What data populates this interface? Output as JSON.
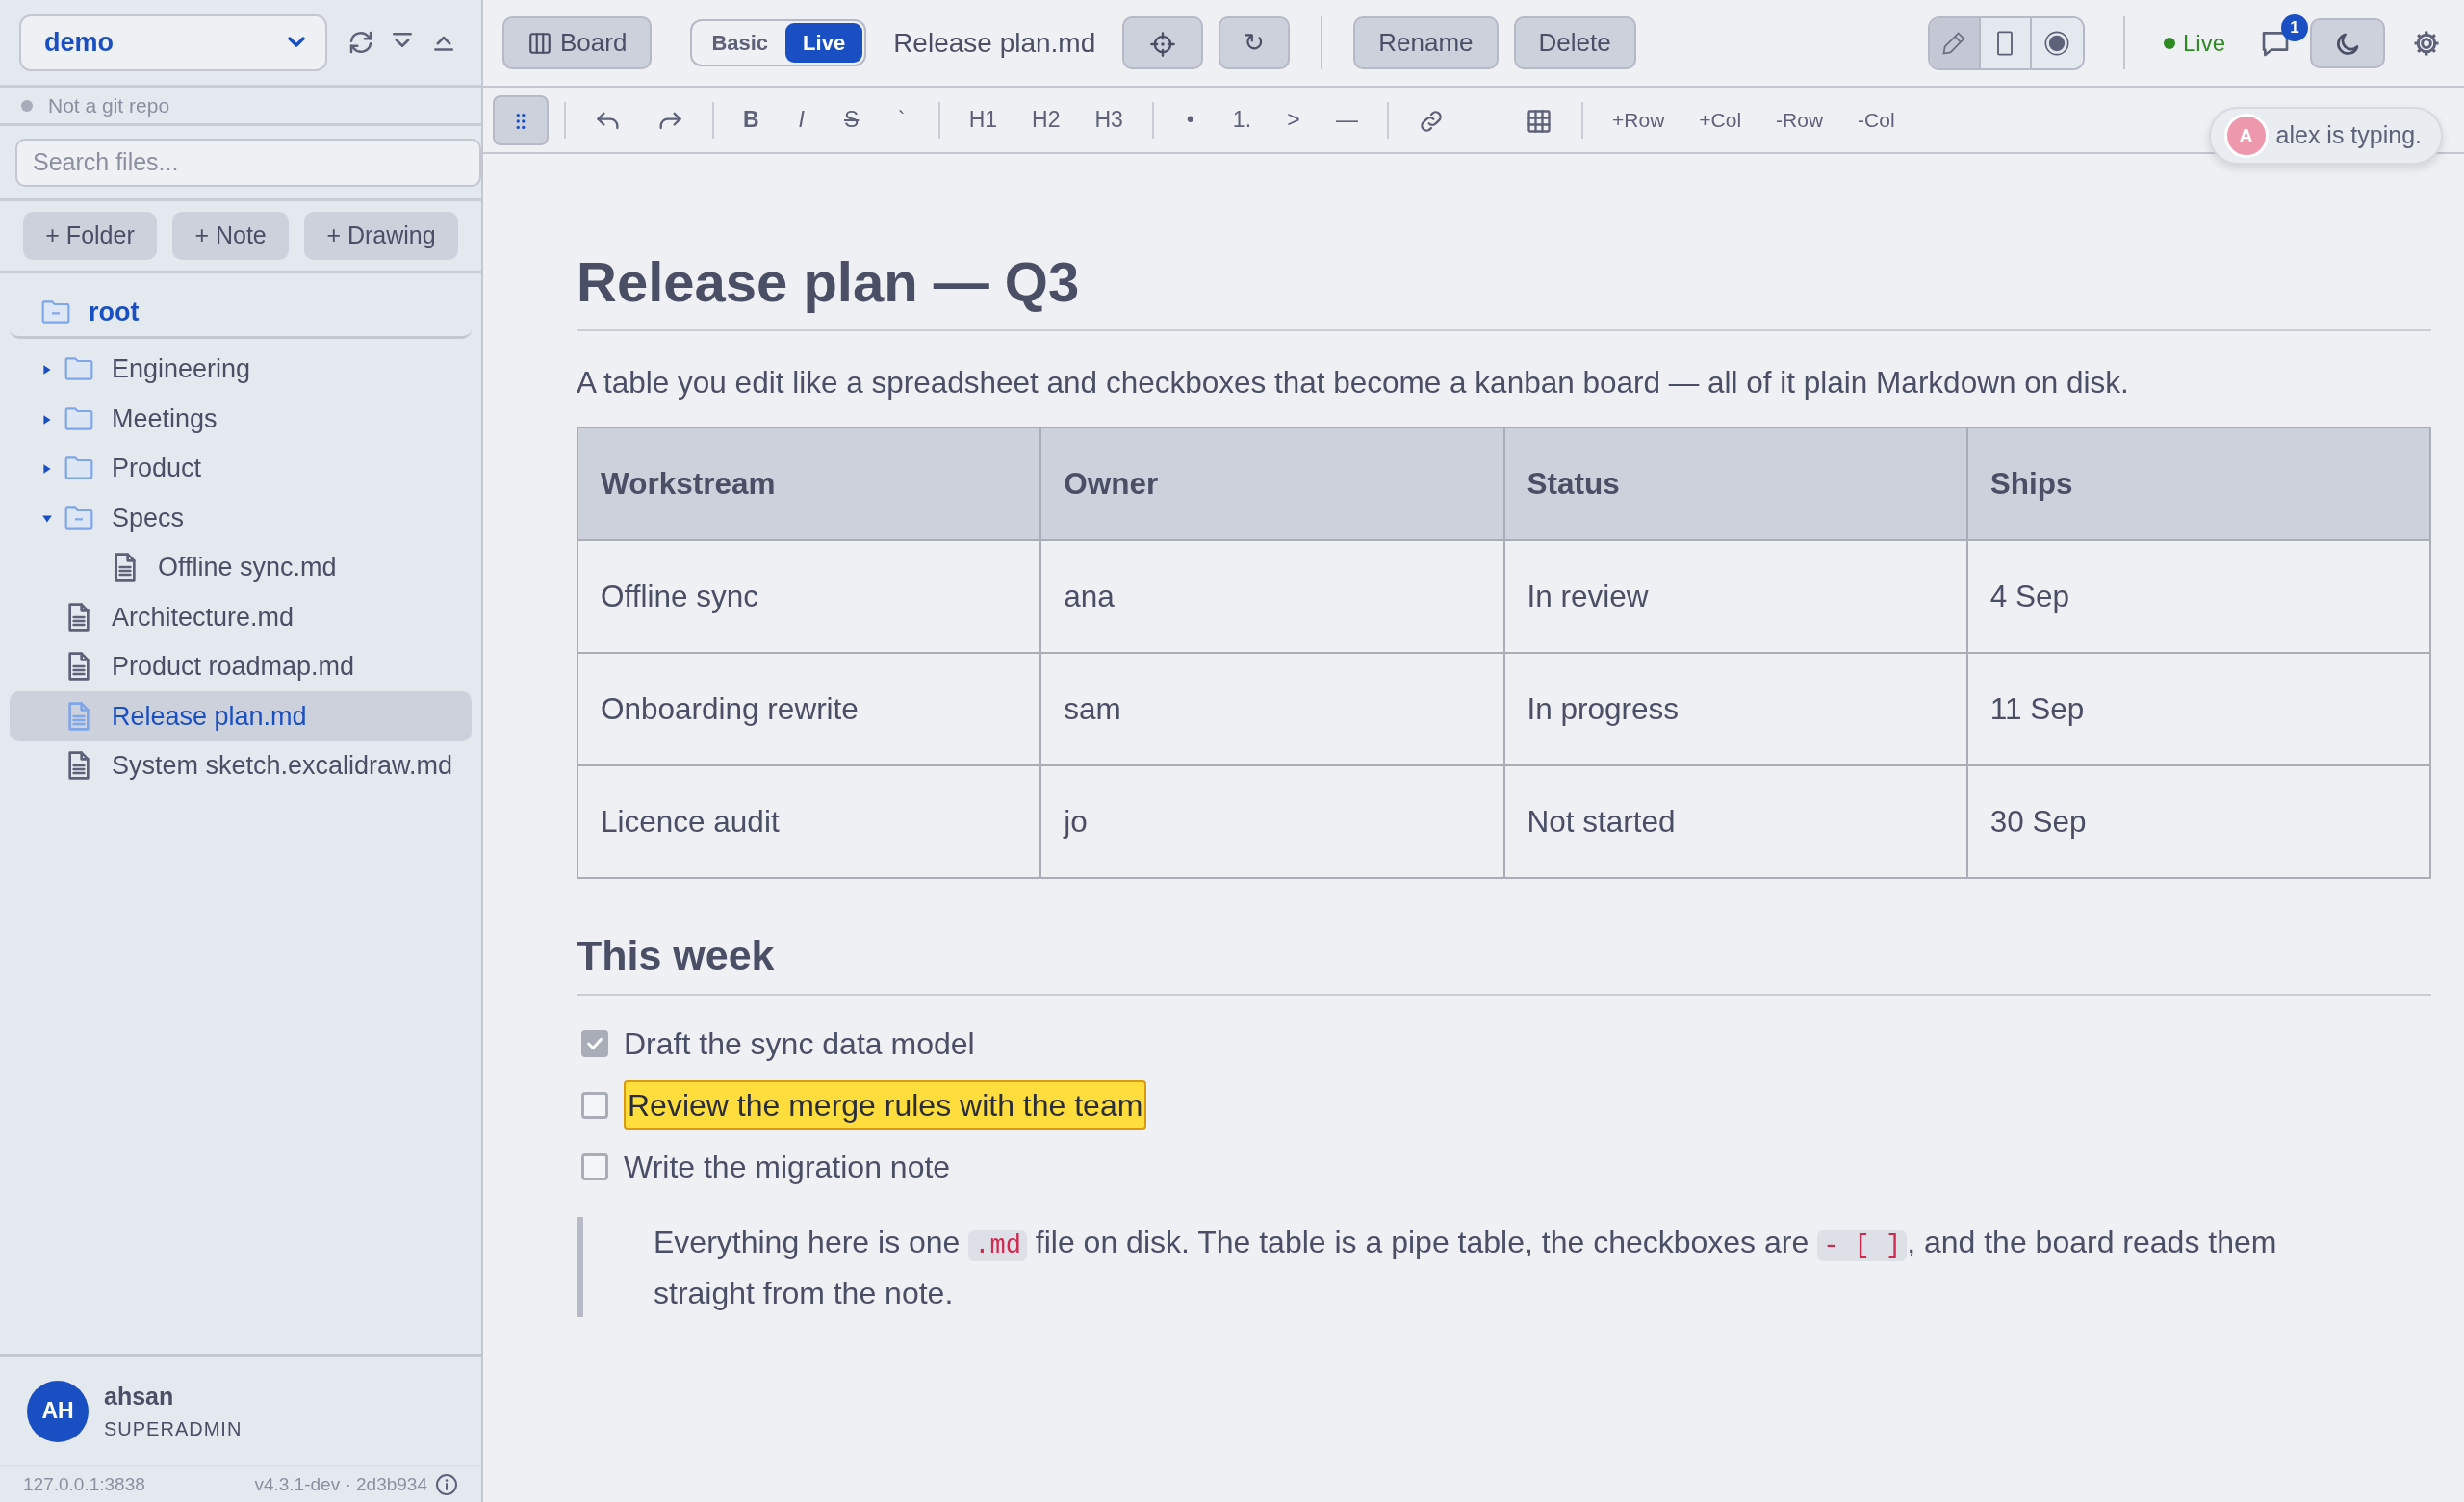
{
  "sidebar": {
    "workspace": "demo",
    "git_status": "Not a git repo",
    "search": {
      "placeholder": "Search files..."
    },
    "create_buttons": [
      "+ Folder",
      "+ Note",
      "+ Drawing"
    ],
    "tree": {
      "label": "root",
      "expanded": true,
      "children": [
        {
          "label": "Engineering",
          "kind": "folder",
          "expanded": false,
          "selected": false
        },
        {
          "label": "Meetings",
          "kind": "folder",
          "expanded": false,
          "selected": false
        },
        {
          "label": "Product",
          "kind": "folder",
          "expanded": false,
          "selected": false
        },
        {
          "label": "Specs",
          "kind": "folder",
          "expanded": true,
          "selected": false,
          "children": [
            {
              "label": "Offline sync.md",
              "kind": "file",
              "selected": false
            }
          ]
        },
        {
          "label": "Architecture.md",
          "kind": "file",
          "selected": false
        },
        {
          "label": "Product roadmap.md",
          "kind": "file",
          "selected": false
        },
        {
          "label": "Release plan.md",
          "kind": "file",
          "selected": true
        },
        {
          "label": "System sketch.excalidraw.md",
          "kind": "file",
          "selected": false
        }
      ]
    },
    "user": {
      "initials": "AH",
      "name": "ahsan",
      "role": "SUPERADMIN"
    },
    "footer": {
      "host": "127.0.0.1:3838",
      "version": "v4.3.1-dev · 2d3b934"
    }
  },
  "topbar": {
    "board_button": "Board",
    "modes": [
      {
        "label": "Basic",
        "selected": false
      },
      {
        "label": "Live",
        "selected": true
      }
    ],
    "file_name": "Release plan.md",
    "reload_button": "↻",
    "actions": [
      "Rename",
      "Delete"
    ],
    "views": [
      {
        "selected": true
      },
      {
        "selected": false
      },
      {
        "selected": false
      }
    ],
    "status": "Live",
    "comments_badge": "1",
    "dark_mode": true
  },
  "toolbar": {
    "handle_active": true,
    "format": [
      "B",
      "I",
      "S",
      "`"
    ],
    "headings": [
      "H1",
      "H2",
      "H3"
    ],
    "blocks": [
      "•",
      "1.",
      ">",
      "—"
    ],
    "table_ops": [
      "+Row",
      "+Col",
      "-Row",
      "-Col"
    ]
  },
  "presence": {
    "initial": "A",
    "text": "alex is typing."
  },
  "document": {
    "title": "Release plan — Q3",
    "intro": "A table you edit like a spreadsheet and checkboxes that become a kanban board — all of it plain Markdown on disk.",
    "table": {
      "columns": [
        "Workstream",
        "Owner",
        "Status",
        "Ships"
      ],
      "rows": [
        [
          "Offline sync",
          "ana",
          "In review",
          "4 Sep"
        ],
        [
          "Onboarding rewrite",
          "sam",
          "In progress",
          "11 Sep"
        ],
        [
          "Licence audit",
          "jo",
          "Not started",
          "30 Sep"
        ]
      ]
    },
    "section": "This week",
    "tasks": [
      {
        "text": "Draft the sync data model",
        "checked": true,
        "highlighted": false
      },
      {
        "text": "Review the merge rules with the team",
        "checked": false,
        "highlighted": true
      },
      {
        "text": "Write the migration note",
        "checked": false,
        "highlighted": false
      }
    ],
    "note": [
      {
        "kind": "text",
        "text": "Everything here is one "
      },
      {
        "kind": "code",
        "text": ".md"
      },
      {
        "kind": "text",
        "text": " file on disk. The table is a pipe table, the checkboxes are "
      },
      {
        "kind": "code",
        "text": "- [ ]"
      },
      {
        "kind": "text",
        "text": ", and the board reads them straight from the note."
      }
    ]
  }
}
